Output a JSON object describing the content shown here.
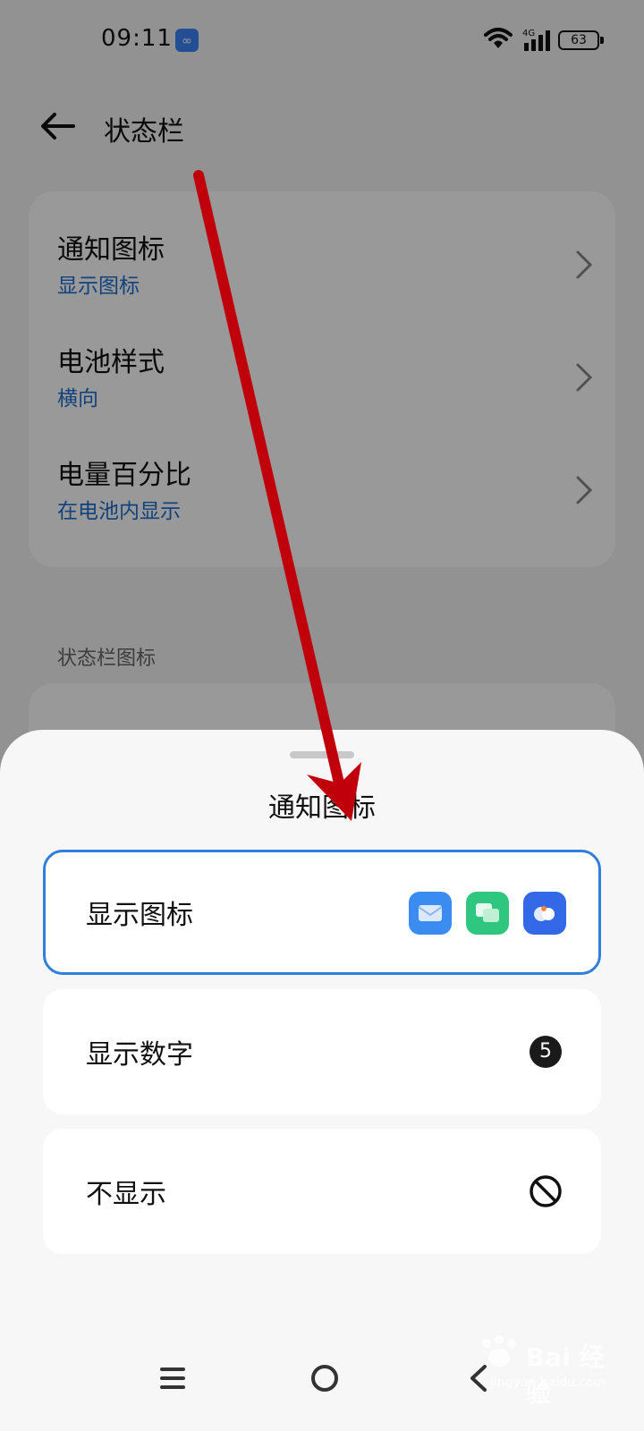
{
  "status_bar": {
    "time": "09:11",
    "battery": "63",
    "network": "4G"
  },
  "header": {
    "title": "状态栏"
  },
  "settings": [
    {
      "title": "通知图标",
      "value": "显示图标"
    },
    {
      "title": "电池样式",
      "value": "横向"
    },
    {
      "title": "电量百分比",
      "value": "在电池内显示"
    }
  ],
  "section": {
    "label": "状态栏图标"
  },
  "sheet": {
    "title": "通知图标",
    "options": [
      {
        "label": "显示图标",
        "selected": true
      },
      {
        "label": "显示数字",
        "badge": "5"
      },
      {
        "label": "不显示"
      }
    ]
  },
  "watermark": {
    "brand": "Bai 经验",
    "url": "jingyan.baidu.com"
  },
  "colors": {
    "accent": "#2f7fdb",
    "link": "#1f6fd1",
    "arrow": "#c0000b",
    "mail_app": "#3b8cf0",
    "chat_app": "#2fc780",
    "app3": "#3369e6"
  }
}
